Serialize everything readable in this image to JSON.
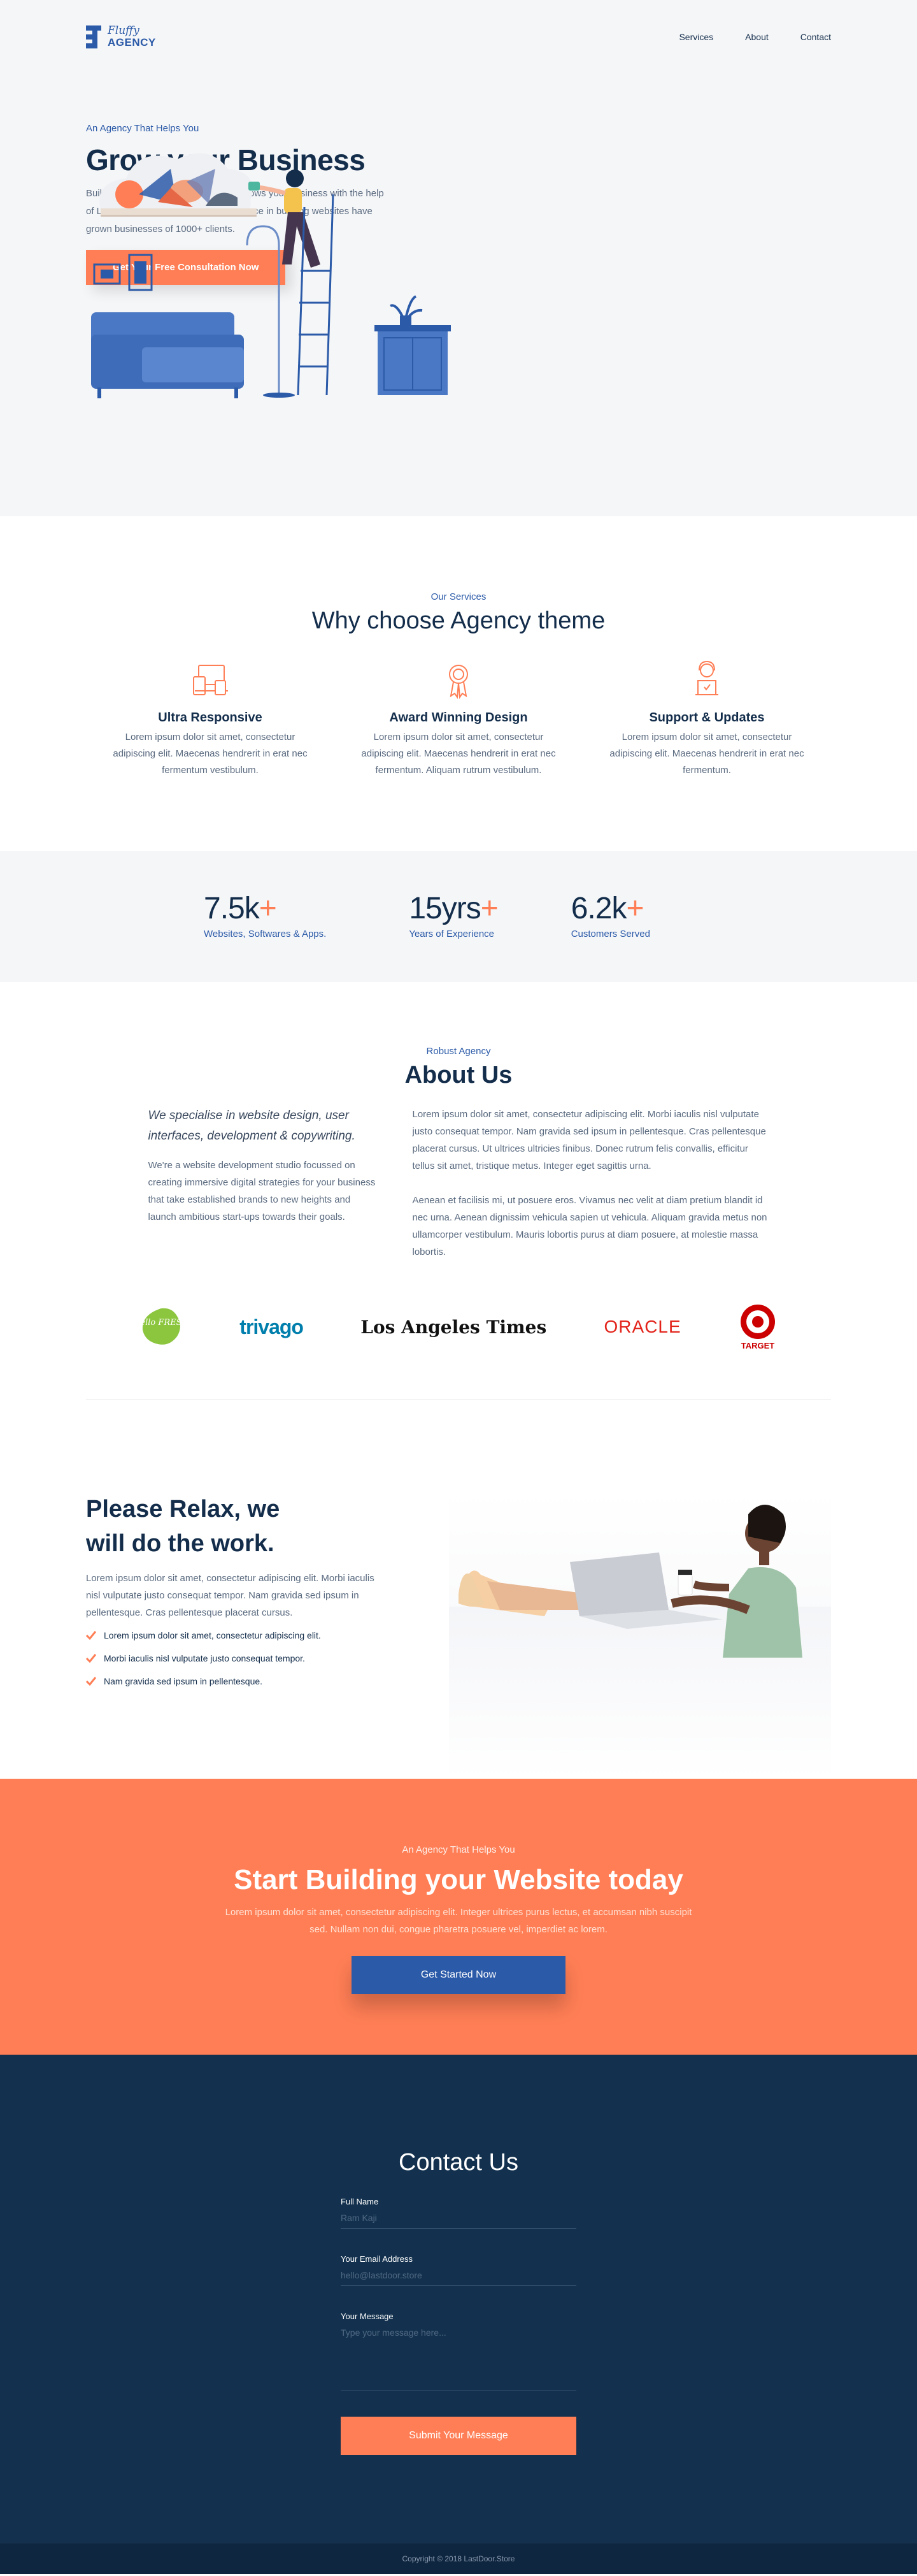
{
  "header": {
    "logo_line1": "Fluffy",
    "logo_line2": "AGENCY",
    "nav": [
      "Services",
      "About",
      "Contact"
    ]
  },
  "hero": {
    "eyebrow": "An Agency That Helps You",
    "title": "Grow your Business",
    "body": "Build an award winning website that grows your business with the help of Last Door.  Our 15+ years of experience in building websites have grown businesses of 1000+ clients.",
    "cta": "Get Your Free Consultation Now"
  },
  "services": {
    "eyebrow": "Our Services",
    "title": "Why choose Agency theme",
    "items": [
      {
        "icon": "devices-icon",
        "title": "Ultra Responsive",
        "body": "Lorem ipsum dolor sit amet, consectetur adipiscing elit. Maecenas hendrerit in erat nec fermentum vestibulum."
      },
      {
        "icon": "award-icon",
        "title": "Award Winning Design",
        "body": "Lorem ipsum dolor sit amet, consectetur adipiscing elit. Maecenas hendrerit in erat nec fermentum. Aliquam rutrum vestibulum."
      },
      {
        "icon": "support-icon",
        "title": "Support & Updates",
        "body": "Lorem ipsum dolor sit amet, consectetur adipiscing elit. Maecenas hendrerit in erat nec fermentum."
      }
    ]
  },
  "stats": [
    {
      "value": "7.5k",
      "plus": "+",
      "label": "Websites, Softwares & Apps."
    },
    {
      "value": "15yrs",
      "plus": "+",
      "label": "Years of Experience"
    },
    {
      "value": "6.2k",
      "plus": "+",
      "label": "Customers Served"
    }
  ],
  "about": {
    "eyebrow": "Robust Agency",
    "title": "About Us",
    "quote": "We specialise in website design, user interfaces, development & copywriting.",
    "left_body": "We're a website development studio focussed on creating immersive digital strategies for your business that take established brands to new heights and launch ambitious start-ups towards their goals.",
    "right_body_1": "Lorem ipsum dolor sit amet, consectetur adipiscing elit. Morbi iaculis nisl vulputate justo consequat tempor. Nam gravida sed ipsum in pellentesque. Cras pellentesque placerat cursus. Ut ultrices ultricies finibus. Donec rutrum felis convallis, efficitur tellus sit amet, tristique metus. Integer eget sagittis urna.",
    "right_body_2": "Aenean et facilisis mi, ut posuere eros. Vivamus nec velit at diam pretium blandit id nec urna. Aenean dignissim vehicula sapien ut vehicula. Aliquam gravida metus non ullamcorper vestibulum. Mauris lobortis purus at diam posuere, at molestie massa lobortis.",
    "logos": {
      "hellofresh": "Hello FRESH",
      "trivago": "trivago",
      "lat": "Los Angeles Times",
      "oracle": "ORACLE",
      "target": "TARGET"
    }
  },
  "relax": {
    "title": "Please Relax, we will do the work.",
    "body": "Lorem ipsum dolor sit amet, consectetur adipiscing elit. Morbi iaculis nisl vulputate justo consequat tempor. Nam gravida sed ipsum in pellentesque. Cras pellentesque placerat cursus.",
    "checks": [
      "Lorem ipsum dolor sit amet, consectetur adipiscing elit.",
      "Morbi iaculis nisl vulputate justo consequat tempor.",
      "Nam gravida sed ipsum in pellentesque."
    ]
  },
  "cta": {
    "eyebrow": "An Agency That Helps You",
    "title": "Start Building your Website today",
    "body": "Lorem ipsum dolor sit amet, consectetur adipiscing elit. Integer ultrices purus lectus, et accumsan nibh suscipit sed. Nullam non dui, congue pharetra posuere vel, imperdiet ac lorem.",
    "button": "Get Started Now"
  },
  "contact": {
    "title": "Contact Us",
    "fields": {
      "name_label": "Full Name",
      "name_placeholder": "Ram Kaji",
      "email_label": "Your Email Address",
      "email_placeholder": "hello@lastdoor.store",
      "message_label": "Your Message",
      "message_placeholder": "Type your message here..."
    },
    "submit": "Submit Your Message"
  },
  "footer": {
    "copyright": "Copyright © 2018 LastDoor.Store"
  },
  "colors": {
    "primary": "#2b5aa8",
    "accent": "#ff7e55",
    "navy": "#13314e",
    "text": "#132d4b"
  }
}
